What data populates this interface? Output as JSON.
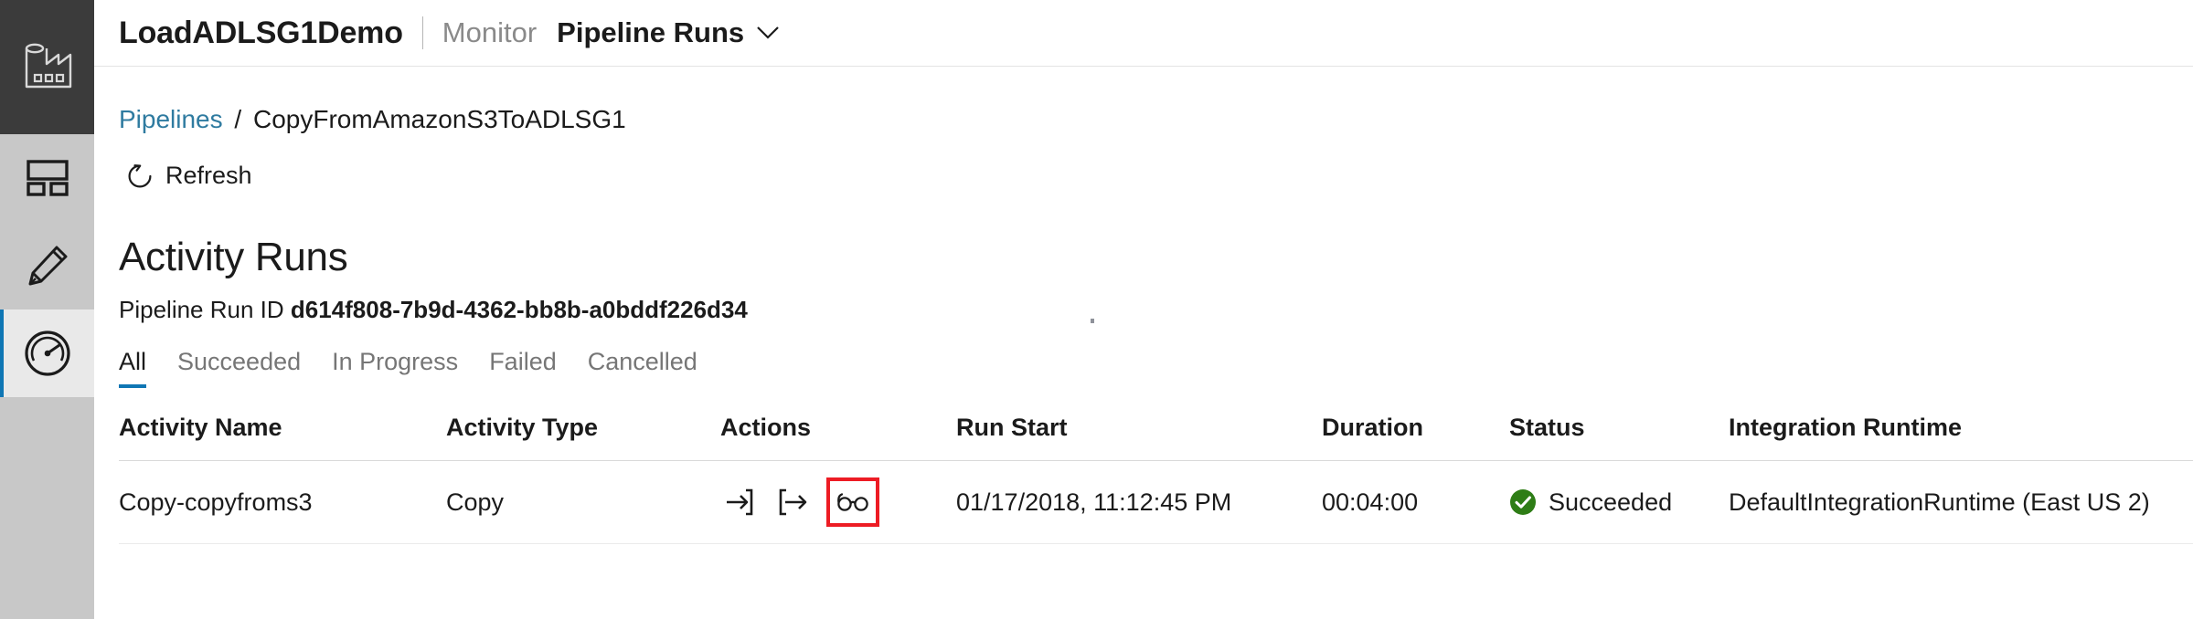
{
  "colors": {
    "rail_bg": "#c8c8c8",
    "rail_logo_bg": "#3b3b3b",
    "accent_blue": "#0f76b4",
    "link_teal": "#2f7ba0",
    "success_green": "#107c10",
    "highlight_red": "#ed1c24",
    "text_primary": "#1b1b1b",
    "text_muted": "#767676"
  },
  "sidebar": {
    "logo": {
      "icon": "factory-icon",
      "name": "Data Factory"
    },
    "items": [
      {
        "icon": "dashboard-icon",
        "name": "Overview",
        "active": false
      },
      {
        "icon": "pencil-icon",
        "name": "Author",
        "active": false
      },
      {
        "icon": "gauge-icon",
        "name": "Monitor",
        "active": true
      }
    ]
  },
  "header": {
    "account": "LoadADLSG1Demo",
    "section": "Monitor",
    "page_select": {
      "label": "Pipeline Runs",
      "chevron_icon": "chevron-down-icon"
    }
  },
  "breadcrumb": {
    "root": "Pipelines",
    "separator": "/",
    "current": "CopyFromAmazonS3ToADLSG1"
  },
  "toolbar": {
    "refresh": {
      "label": "Refresh",
      "icon": "refresh-icon"
    }
  },
  "main": {
    "title": "Activity Runs",
    "run_id_label": "Pipeline Run ID",
    "run_id_value": "d614f808-7b9d-4362-bb8b-a0bddf226d34"
  },
  "tabs": [
    {
      "label": "All",
      "active": true
    },
    {
      "label": "Succeeded",
      "active": false
    },
    {
      "label": "In Progress",
      "active": false
    },
    {
      "label": "Failed",
      "active": false
    },
    {
      "label": "Cancelled",
      "active": false
    }
  ],
  "table": {
    "columns": [
      "Activity Name",
      "Activity Type",
      "Actions",
      "Run Start",
      "Duration",
      "Status",
      "Integration Runtime"
    ],
    "rows": [
      {
        "activity_name": "Copy-copyfroms3",
        "activity_type": "Copy",
        "actions": [
          {
            "icon": "input-arrow-icon",
            "name": "view-input",
            "highlighted": false
          },
          {
            "icon": "output-arrow-icon",
            "name": "view-output",
            "highlighted": false
          },
          {
            "icon": "glasses-icon",
            "name": "view-details",
            "highlighted": true
          }
        ],
        "run_start": "01/17/2018, 11:12:45 PM",
        "duration": "00:04:00",
        "status": "Succeeded",
        "status_icon": "success-check-icon",
        "integration_runtime": "DefaultIntegrationRuntime (East US 2)"
      }
    ]
  }
}
